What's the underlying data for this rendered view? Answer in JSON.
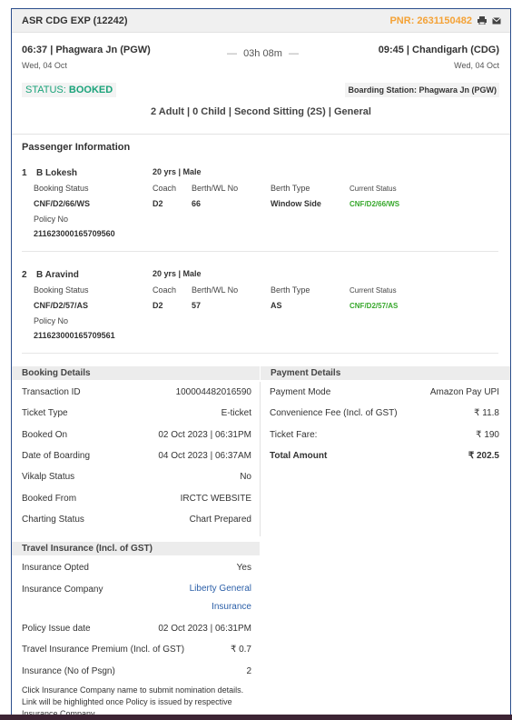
{
  "header": {
    "train": "ASR CDG EXP (12242)",
    "pnr_label": "PNR:",
    "pnr": "2631150482",
    "print_icon": "printer-icon",
    "mail_icon": "envelope-icon"
  },
  "journey": {
    "from_time_station": "06:37 | Phagwara Jn (PGW)",
    "from_date": "Wed, 04 Oct",
    "duration": "03h 08m",
    "to_time_station": "09:45 | Chandigarh (CDG)",
    "to_date": "Wed, 04 Oct"
  },
  "status": {
    "label": "STATUS:",
    "value": "BOOKED",
    "boarding": "Boarding Station: Phagwara Jn (PGW)",
    "class_info": "2 Adult | 0 Child | Second Sitting (2S) | General"
  },
  "passenger_info": {
    "title": "Passenger Information",
    "labels": {
      "booking_status": "Booking Status",
      "coach": "Coach",
      "berth_no": "Berth/WL No",
      "berth_type": "Berth Type",
      "current_status": "Current Status",
      "policy_no": "Policy No"
    },
    "passengers": [
      {
        "num": "1",
        "name": "B Lokesh",
        "age_gender": "20 yrs | Male",
        "booking_status": "CNF/D2/66/WS",
        "coach": "D2",
        "berth_no": "66",
        "berth_type": "Window Side",
        "current_status": "CNF/D2/66/WS",
        "policy_no": "211623000165709560"
      },
      {
        "num": "2",
        "name": "B Aravind",
        "age_gender": "20 yrs | Male",
        "booking_status": "CNF/D2/57/AS",
        "coach": "D2",
        "berth_no": "57",
        "berth_type": "AS",
        "current_status": "CNF/D2/57/AS",
        "policy_no": "211623000165709561"
      }
    ]
  },
  "booking_details": {
    "title": "Booking Details",
    "rows": [
      {
        "label": "Transaction ID",
        "value": "100004482016590"
      },
      {
        "label": "Ticket Type",
        "value": "E-ticket"
      },
      {
        "label": "Booked On",
        "value": "02 Oct 2023 | 06:31PM"
      },
      {
        "label": "Date of Boarding",
        "value": "04 Oct 2023 | 06:37AM"
      },
      {
        "label": "Vikalp Status",
        "value": "No"
      },
      {
        "label": "Booked From",
        "value": "IRCTC WEBSITE"
      },
      {
        "label": "Charting Status",
        "value": "Chart Prepared"
      }
    ]
  },
  "payment_details": {
    "title": "Payment Details",
    "rows": [
      {
        "label": "Payment Mode",
        "value": "Amazon Pay UPI"
      },
      {
        "label": "Convenience Fee (Incl. of GST)",
        "value": "₹ 11.8"
      },
      {
        "label": "Ticket Fare:",
        "value": "₹ 190"
      },
      {
        "label": "Total Amount",
        "value": "₹ 202.5"
      }
    ]
  },
  "insurance": {
    "title": "Travel Insurance (Incl. of GST)",
    "opted_label": "Insurance Opted",
    "opted_value": "Yes",
    "company_label": "Insurance Company",
    "company_line1": "Liberty General",
    "company_line2": "Insurance",
    "issue_label": "Policy Issue date",
    "issue_value": "02 Oct 2023 | 06:31PM",
    "premium_label": "Travel Insurance Premium (Incl. of GST)",
    "premium_value": "₹ 0.7",
    "count_label": "Insurance (No of Psgn)",
    "count_value": "2",
    "note": "Click Insurance Company name to submit nomination details. Link will be highlighted once Policy is issued by respective Insurance Company."
  }
}
